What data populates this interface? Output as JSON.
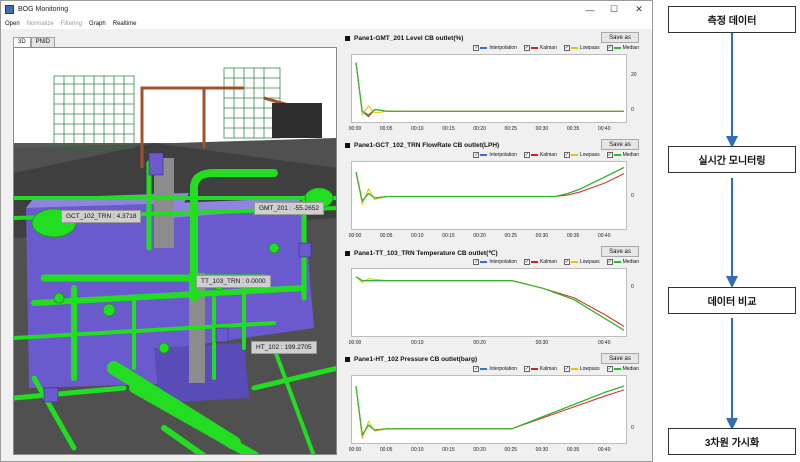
{
  "window": {
    "title": "BOG Monitoring",
    "min_glyph": "—",
    "max_glyph": "☐",
    "close_glyph": "✕"
  },
  "menu": [
    {
      "label": "Open",
      "enabled": true
    },
    {
      "label": "Normalize",
      "enabled": false
    },
    {
      "label": "Filtering",
      "enabled": false
    },
    {
      "label": "Graph",
      "enabled": true
    },
    {
      "label": "Realtime",
      "enabled": true
    }
  ],
  "tabs": [
    {
      "label": "3D"
    },
    {
      "label": "PNID"
    }
  ],
  "active_tab": "3D",
  "tags": [
    {
      "label": "GCT_102_TRN :  4.3718"
    },
    {
      "label": "GMT_201 :  -55.2652"
    },
    {
      "label": "TT_103_TRN :  0.0000"
    },
    {
      "label": "HT_102 :  199.2705"
    }
  ],
  "colors": {
    "pipe": "#22dd22",
    "tank": "#6a5acd",
    "interpolation": "#3a6fd8",
    "kalman": "#d62020",
    "lowpass": "#e8c200",
    "median": "#2db82d",
    "flow_arrow": "#2f6db8"
  },
  "legend": [
    {
      "label": "Interpolation",
      "color_key": "interpolation",
      "checked": true
    },
    {
      "label": "Kalman",
      "color_key": "kalman",
      "checked": true
    },
    {
      "label": "Lowpass",
      "color_key": "lowpass",
      "checked": true
    },
    {
      "label": "Median",
      "color_key": "median",
      "checked": true
    }
  ],
  "save_label": "Save as",
  "panes": [
    {
      "title": "Pane1-GMT_201 Level CB outlet(%)"
    },
    {
      "title": "Pane1-GCT_102_TRN FlowRate CB outlet(LPH)"
    },
    {
      "title": "Pane1-TT_103_TRN Temperature CB outlet(℃)"
    },
    {
      "title": "Pane1-HT_102 Pressure CB outlet(barg)"
    }
  ],
  "flow_steps": [
    {
      "label": "측정 데이터"
    },
    {
      "label": "실시간 모니터링"
    },
    {
      "label": "데이터 비교"
    },
    {
      "label": "3차원 가시화"
    }
  ],
  "chart_data": [
    {
      "type": "line",
      "title": "Pane1-GMT_201 Level CB outlet(%)",
      "x_ticks": [
        "00:00",
        "00:05",
        "00:10",
        "00:15",
        "00:20",
        "00:25",
        "00:30",
        "00:35",
        "00:40"
      ],
      "y_ticks": [
        {
          "label": "20",
          "value": 20
        },
        {
          "label": "0",
          "value": 0
        }
      ],
      "ylim": [
        -5,
        30
      ],
      "x": [
        0,
        1,
        2,
        3,
        5,
        10,
        20,
        30,
        43
      ],
      "series": [
        {
          "name": "Interpolation",
          "values": [
            28,
            0,
            -3,
            1,
            0,
            0,
            0,
            0,
            0
          ]
        },
        {
          "name": "Kalman",
          "values": [
            28,
            0,
            -3,
            1,
            0,
            0,
            0,
            0,
            0
          ]
        },
        {
          "name": "Lowpass",
          "values": [
            28,
            -2,
            3,
            -1,
            0,
            0,
            0,
            0,
            0
          ]
        },
        {
          "name": "Median",
          "values": [
            28,
            0,
            -2,
            1,
            0,
            0,
            0,
            0,
            0
          ]
        }
      ]
    },
    {
      "type": "line",
      "title": "Pane1-GCT_102_TRN FlowRate CB outlet(LPH)",
      "x_ticks": [
        "00:00",
        "00:05",
        "00:10",
        "00:15",
        "00:20",
        "00:25",
        "00:30",
        "00:35",
        "00:40"
      ],
      "y_ticks": [
        {
          "label": "0",
          "value": 0
        }
      ],
      "ylim": [
        -20,
        20
      ],
      "x": [
        0,
        1,
        2,
        3,
        5,
        10,
        20,
        30,
        32,
        34,
        36,
        38,
        40,
        42,
        43
      ],
      "series": [
        {
          "name": "Interpolation",
          "values": [
            16,
            -3,
            2,
            -1,
            0,
            0,
            0,
            0,
            0,
            2,
            5,
            9,
            13,
            17,
            19
          ]
        },
        {
          "name": "Kalman",
          "values": [
            16,
            -3,
            2,
            -1,
            0,
            0,
            0,
            0,
            0,
            1,
            3,
            6,
            9,
            13,
            15
          ]
        },
        {
          "name": "Lowpass",
          "values": [
            16,
            -5,
            5,
            -2,
            0,
            0,
            0,
            0,
            0,
            2,
            5,
            9,
            13,
            17,
            19
          ]
        },
        {
          "name": "Median",
          "values": [
            16,
            -3,
            2,
            -1,
            0,
            0,
            0,
            0,
            0,
            2,
            5,
            9,
            13,
            17,
            19
          ]
        }
      ]
    },
    {
      "type": "line",
      "title": "Pane1-TT_103_TRN Temperature CB outlet(℃)",
      "x_ticks": [
        "00:00",
        "00:10",
        "00:20",
        "00:30",
        "00:40"
      ],
      "y_ticks": [
        {
          "label": "0",
          "value": 0
        }
      ],
      "ylim": [
        -12,
        4
      ],
      "x": [
        0,
        1,
        2,
        5,
        10,
        20,
        25,
        30,
        35,
        40,
        43
      ],
      "series": [
        {
          "name": "Interpolation",
          "values": [
            3,
            2,
            2,
            2,
            2,
            2,
            2,
            0,
            -3,
            -8,
            -11
          ]
        },
        {
          "name": "Kalman",
          "values": [
            3,
            2,
            2,
            2,
            2,
            2,
            2,
            0,
            -2.5,
            -7,
            -10
          ]
        },
        {
          "name": "Lowpass",
          "values": [
            3,
            1.5,
            2.5,
            2,
            2,
            2,
            2,
            0,
            -3,
            -8,
            -11
          ]
        },
        {
          "name": "Median",
          "values": [
            3,
            2,
            2,
            2,
            2,
            2,
            2,
            0,
            -3,
            -8,
            -11
          ]
        }
      ]
    },
    {
      "type": "line",
      "title": "Pane1-HT_102 Pressure CB outlet(barg)",
      "x_ticks": [
        "00:00",
        "00:05",
        "00:10",
        "00:15",
        "00:20",
        "00:25",
        "00:30",
        "00:35",
        "00:40"
      ],
      "y_ticks": [
        {
          "label": "0",
          "value": 0
        }
      ],
      "ylim": [
        -10,
        40
      ],
      "x": [
        0,
        1,
        2,
        3,
        5,
        10,
        20,
        25,
        30,
        35,
        40,
        43
      ],
      "series": [
        {
          "name": "Interpolation",
          "values": [
            35,
            -5,
            3,
            -1,
            0,
            0,
            0,
            0,
            10,
            20,
            30,
            35
          ]
        },
        {
          "name": "Kalman",
          "values": [
            35,
            -5,
            3,
            -1,
            0,
            0,
            0,
            0,
            9,
            18,
            27,
            32
          ]
        },
        {
          "name": "Lowpass",
          "values": [
            35,
            -8,
            6,
            -2,
            0,
            0,
            0,
            0,
            10,
            20,
            30,
            35
          ]
        },
        {
          "name": "Median",
          "values": [
            35,
            -5,
            3,
            -1,
            0,
            0,
            0,
            0,
            10,
            20,
            30,
            35
          ]
        }
      ]
    }
  ]
}
